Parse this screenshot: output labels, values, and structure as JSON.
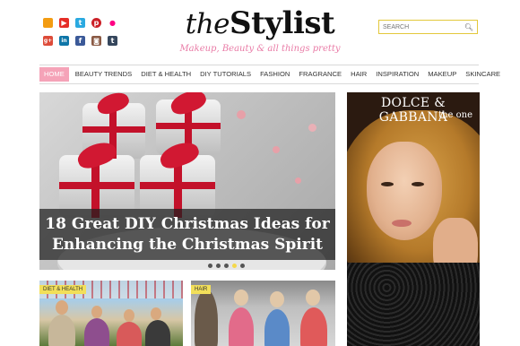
{
  "social": [
    {
      "name": "rss-icon",
      "glyph": "",
      "color": "#f39c12"
    },
    {
      "name": "youtube-icon",
      "glyph": "▶",
      "color": "#e52d27"
    },
    {
      "name": "twitter-icon",
      "glyph": "t",
      "color": "#2aa9e0"
    },
    {
      "name": "pinterest-icon",
      "glyph": "p",
      "color": "#cb2027"
    },
    {
      "name": "flickr-icon",
      "glyph": "●",
      "color": "#ff0084"
    },
    {
      "name": "google-plus-icon",
      "glyph": "g+",
      "color": "#dd4b39"
    },
    {
      "name": "linkedin-icon",
      "glyph": "in",
      "color": "#0e76a8"
    },
    {
      "name": "facebook-icon",
      "glyph": "f",
      "color": "#3b5998"
    },
    {
      "name": "instagram-icon",
      "glyph": "◙",
      "color": "#8a5a44"
    },
    {
      "name": "tumblr-icon",
      "glyph": "t",
      "color": "#35465c"
    }
  ],
  "logo": {
    "the": "the",
    "stylist": "Stylist",
    "tagline": "Makeup, Beauty & all things pretty"
  },
  "search": {
    "placeholder": "SEARCH"
  },
  "nav": [
    "HOME",
    "BEAUTY TRENDS",
    "DIET & HEALTH",
    "DIY TUTORIALS",
    "FASHION",
    "FRAGRANCE",
    "HAIR",
    "INSPIRATION",
    "MAKEUP",
    "SKINCARE"
  ],
  "hero": {
    "title_line1": "18 Great DIY Christmas Ideas for",
    "title_line2": "Enhancing the Christmas Spirit",
    "slides": 5,
    "active_slide": 4
  },
  "ad": {
    "brand": "DOLCE & GABBANA",
    "sub": "the one",
    "bottle_label": "DOLCE & GABBANA the one"
  },
  "cards": [
    {
      "category": "DIET & HEALTH"
    },
    {
      "category": "HAIR"
    }
  ],
  "colors": {
    "accent_pink": "#f5a3b8",
    "badge_yellow": "#f2df5a",
    "search_border": "#e3c83b"
  }
}
